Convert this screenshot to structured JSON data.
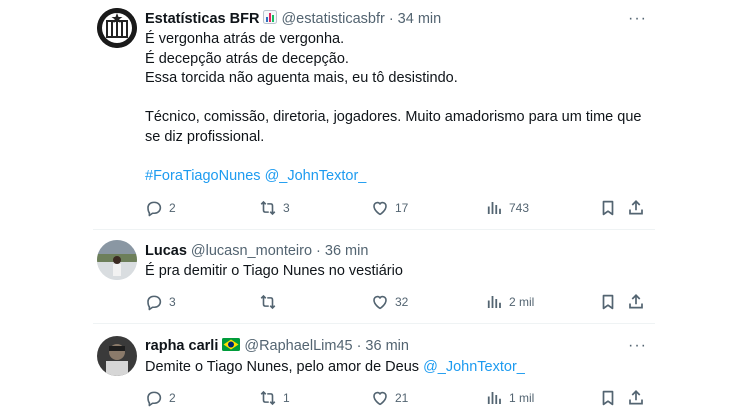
{
  "tweets": [
    {
      "name": "Estatísticas BFR",
      "badge": "📊",
      "handle": "@estatisticasbfr",
      "dot": "·",
      "time": "34 min",
      "lines": [
        "É vergonha atrás de vergonha.",
        "É decepção atrás de decepção.",
        "Essa torcida não aguenta mais, eu tô desistindo.",
        "",
        "Técnico, comissão, diretoria, jogadores. Muito amadorismo para um time que",
        "se diz profissional."
      ],
      "hashtag": "#ForaTiagoNunes",
      "mention": "@_JohnTextor_",
      "replies": "2",
      "retweets": "3",
      "likes": "17",
      "views": "743"
    },
    {
      "name": "Lucas",
      "handle": "@lucasn_monteiro",
      "dot": "·",
      "time": "36 min",
      "text": "É pra demitir o Tiago Nunes no vestiário",
      "replies": "3",
      "retweets": "",
      "likes": "32",
      "views": "2 mil"
    },
    {
      "name": "rapha carli",
      "badge": "🇧🇷",
      "handle": "@RaphaelLim45",
      "dot": "·",
      "time": "36 min",
      "text": "Demite o Tiago Nunes, pelo amor de Deus",
      "mention": "@_JohnTextor_",
      "replies": "2",
      "retweets": "1",
      "likes": "21",
      "views": "1 mil"
    }
  ],
  "more_label": "···",
  "colors": {
    "link": "#1d9bf0",
    "muted": "#536471",
    "text": "#0f1419",
    "badge_flag": "#009c3b"
  }
}
